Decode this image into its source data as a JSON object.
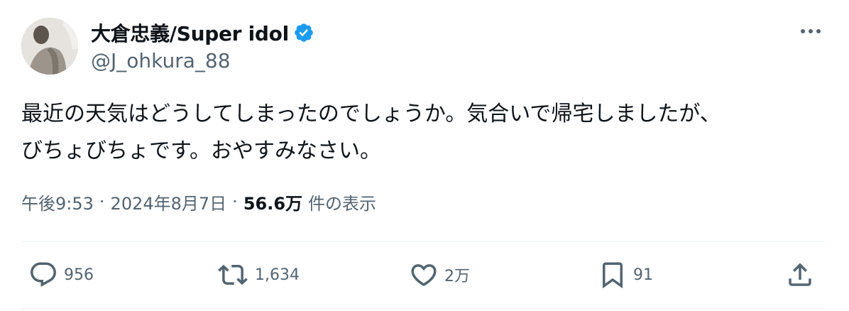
{
  "author": {
    "display_name": "大倉忠義/Super idol",
    "handle": "@J_ohkura_88",
    "verified": true
  },
  "tweet": {
    "text": "最近の天気はどうしてしまったのでしょうか。気合いで帰宅しましたが、\nびちょびちょです。おやすみなさい。"
  },
  "meta": {
    "time": "午後9:53",
    "separator": "·",
    "date": "2024年8月7日",
    "views_count": "56.6万",
    "views_label": "件の表示"
  },
  "actions": {
    "reply_count": "956",
    "retweet_count": "1,634",
    "like_count": "2万",
    "bookmark_count": "91"
  },
  "colors": {
    "text_primary": "#0f1419",
    "text_secondary": "#536471",
    "verified_blue": "#1d9bf0",
    "divider": "#eff3f4"
  },
  "icons": {
    "more": "more-horizontal-icon",
    "verified": "verified-badge-icon",
    "reply": "reply-icon",
    "retweet": "retweet-icon",
    "like": "heart-icon",
    "bookmark": "bookmark-icon",
    "share": "share-icon"
  }
}
